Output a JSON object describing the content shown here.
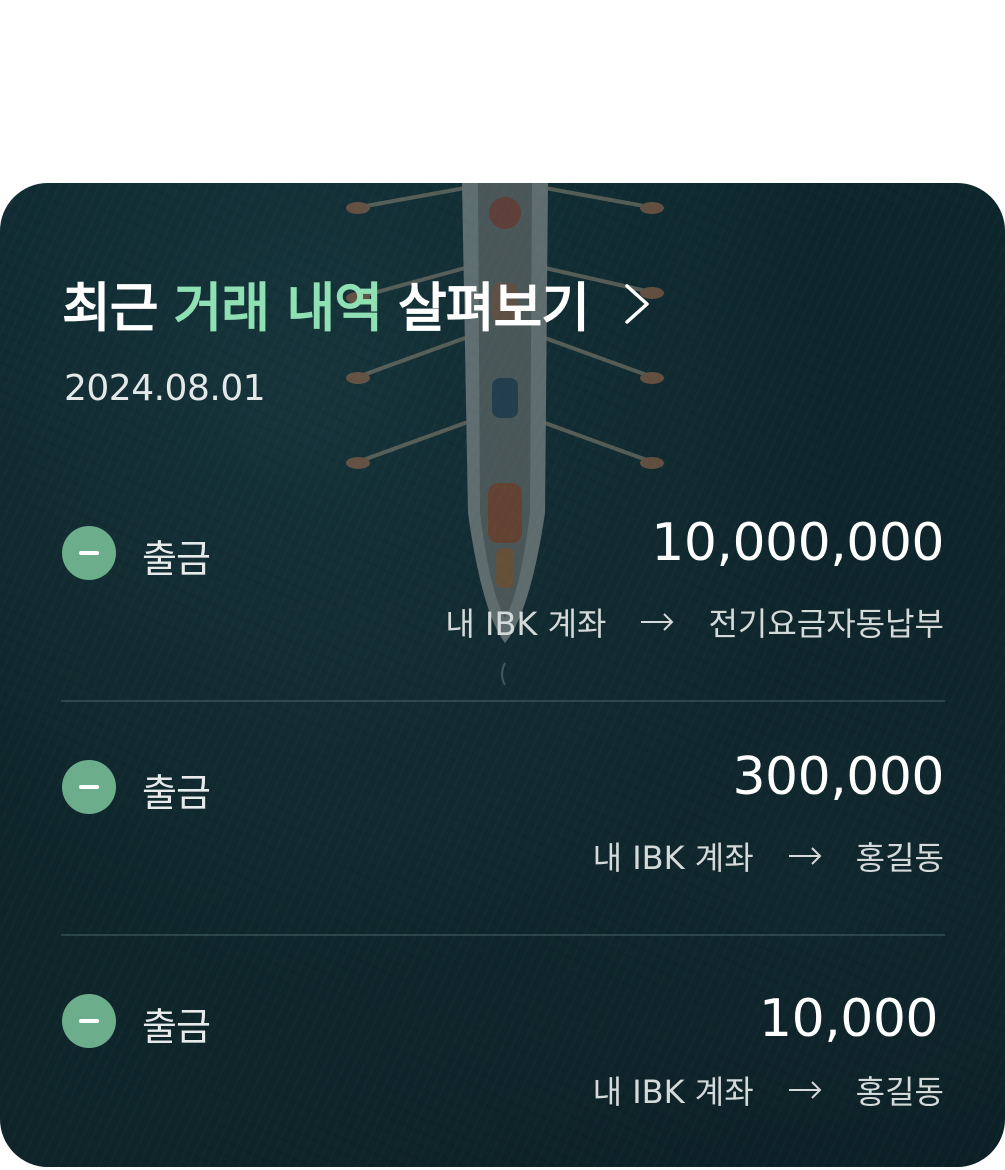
{
  "header": {
    "title_prefix": "최근",
    "title_accent": "거래 내역",
    "title_suffix": "살펴보기"
  },
  "date": "2024.08.01",
  "transactions": [
    {
      "type": "출금",
      "amount": "10,000,000",
      "from": "내 IBK 계좌",
      "to": "전기요금자동납부"
    },
    {
      "type": "출금",
      "amount": "300,000",
      "from": "내 IBK 계좌",
      "to": "홍길동"
    },
    {
      "type": "출금",
      "amount": "10,000",
      "from": "내 IBK 계좌",
      "to": "홍길동"
    }
  ],
  "colors": {
    "accent": "#8fe0b3",
    "withdraw_badge": "#6cae8c",
    "card_bg": "#0c2429"
  },
  "icons": {
    "header_link": "chevron-right-icon",
    "withdraw": "minus-circle-icon",
    "route": "arrow-right-icon"
  }
}
